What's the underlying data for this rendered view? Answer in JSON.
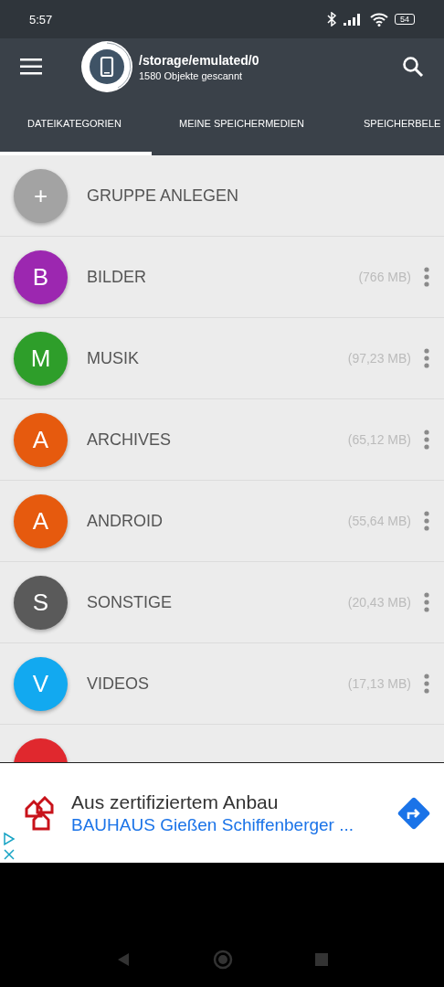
{
  "status_bar": {
    "time": "5:57",
    "battery": "54"
  },
  "header": {
    "path": "/storage/emulated/0",
    "scanned": "1580 Objekte gescannt"
  },
  "tabs": [
    {
      "label": "DATEIKATEGORIEN",
      "selected": true
    },
    {
      "label": "MEINE SPEICHERMEDIEN",
      "selected": false
    },
    {
      "label": "SPEICHERBELE",
      "selected": false
    }
  ],
  "add_group": {
    "symbol": "+",
    "label": "GRUPPE ANLEGEN"
  },
  "categories": [
    {
      "letter": "B",
      "name": "BILDER",
      "size": "(766 MB)",
      "color": "#9c27b0"
    },
    {
      "letter": "M",
      "name": "MUSIK",
      "size": "(97,23 MB)",
      "color": "#2e9e2a"
    },
    {
      "letter": "A",
      "name": "ARCHIVES",
      "size": "(65,12 MB)",
      "color": "#e65a0e"
    },
    {
      "letter": "A",
      "name": "ANDROID",
      "size": "(55,64 MB)",
      "color": "#e65a0e"
    },
    {
      "letter": "S",
      "name": "SONSTIGE",
      "size": "(20,43 MB)",
      "color": "#5a5a5a"
    },
    {
      "letter": "V",
      "name": "VIDEOS",
      "size": "(17,13 MB)",
      "color": "#12a9f0"
    },
    {
      "color": "#e0282e"
    }
  ],
  "ad": {
    "headline": "Aus zertifiziertem Anbau",
    "advertiser": "BAUHAUS Gießen Schiffenberger ..."
  }
}
